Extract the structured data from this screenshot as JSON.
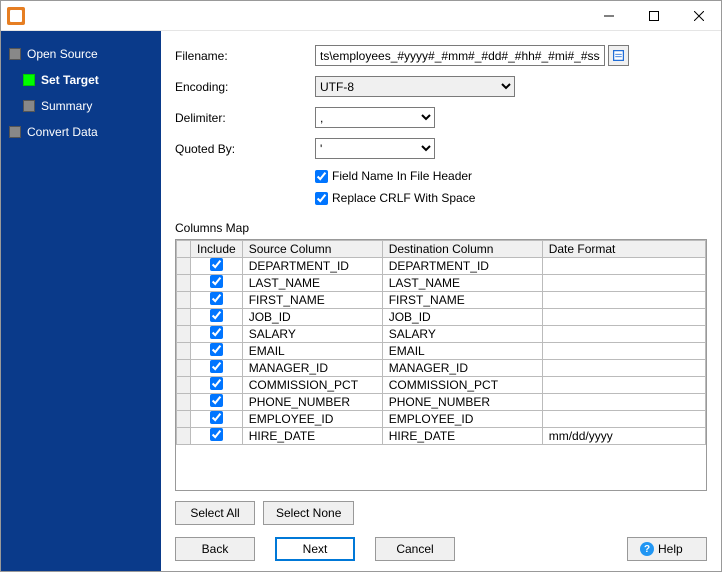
{
  "titlebar": {
    "title": ""
  },
  "sidebar": {
    "steps": [
      {
        "label": "Open Source",
        "active": false,
        "child": false
      },
      {
        "label": "Set Target",
        "active": true,
        "child": true
      },
      {
        "label": "Summary",
        "active": false,
        "child": true
      },
      {
        "label": "Convert Data",
        "active": false,
        "child": false
      }
    ]
  },
  "form": {
    "filename_label": "Filename:",
    "filename_value": "ts\\employees_#yyyy#_#mm#_#dd#_#hh#_#mi#_#ss#.csv",
    "encoding_label": "Encoding:",
    "encoding_value": "UTF-8",
    "delimiter_label": "Delimiter:",
    "delimiter_value": ",",
    "quoted_label": "Quoted By:",
    "quoted_value": "'",
    "chk_header_label": "Field Name In File Header",
    "chk_header_checked": true,
    "chk_crlf_label": "Replace CRLF With Space",
    "chk_crlf_checked": true
  },
  "columns_section_label": "Columns Map",
  "grid": {
    "headers": {
      "include": "Include",
      "source": "Source Column",
      "dest": "Destination Column",
      "datefmt": "Date Format"
    },
    "rows": [
      {
        "include": true,
        "source": "DEPARTMENT_ID",
        "dest": "DEPARTMENT_ID",
        "datefmt": ""
      },
      {
        "include": true,
        "source": "LAST_NAME",
        "dest": "LAST_NAME",
        "datefmt": ""
      },
      {
        "include": true,
        "source": "FIRST_NAME",
        "dest": "FIRST_NAME",
        "datefmt": ""
      },
      {
        "include": true,
        "source": "JOB_ID",
        "dest": "JOB_ID",
        "datefmt": ""
      },
      {
        "include": true,
        "source": "SALARY",
        "dest": "SALARY",
        "datefmt": ""
      },
      {
        "include": true,
        "source": "EMAIL",
        "dest": "EMAIL",
        "datefmt": ""
      },
      {
        "include": true,
        "source": "MANAGER_ID",
        "dest": "MANAGER_ID",
        "datefmt": ""
      },
      {
        "include": true,
        "source": "COMMISSION_PCT",
        "dest": "COMMISSION_PCT",
        "datefmt": ""
      },
      {
        "include": true,
        "source": "PHONE_NUMBER",
        "dest": "PHONE_NUMBER",
        "datefmt": ""
      },
      {
        "include": true,
        "source": "EMPLOYEE_ID",
        "dest": "EMPLOYEE_ID",
        "datefmt": ""
      },
      {
        "include": true,
        "source": "HIRE_DATE",
        "dest": "HIRE_DATE",
        "datefmt": "mm/dd/yyyy"
      }
    ]
  },
  "buttons": {
    "select_all": "Select All",
    "select_none": "Select None",
    "back": "Back",
    "next": "Next",
    "cancel": "Cancel",
    "help": "Help"
  }
}
